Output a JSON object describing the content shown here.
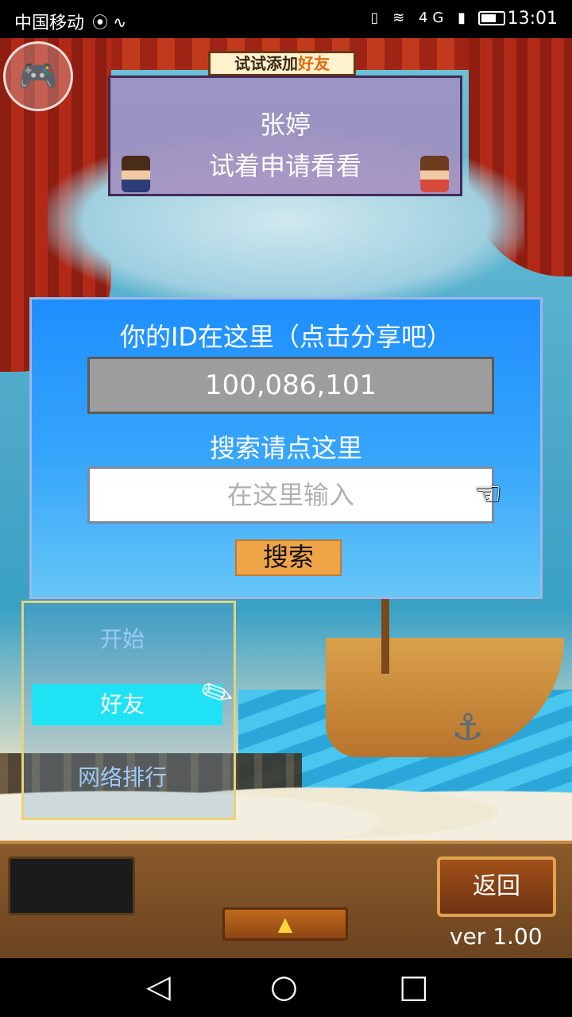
{
  "status_bar": {
    "carrier": "中国移动",
    "left_icons": "⦿ ∿",
    "right_icons": "▯ ≋ 4G ▮",
    "time": "13:01"
  },
  "banner": {
    "tag_prefix": "试试添加",
    "tag_highlight": "好友",
    "name": "张婷",
    "message": "试着申请看看"
  },
  "id_dialog": {
    "title": "你的ID在这里（点击分享吧）",
    "id_value": "100,086,101",
    "search_title": "搜索请点这里",
    "search_placeholder": "在这里输入",
    "search_button": "搜索"
  },
  "menu": {
    "items": [
      "开始",
      "好友",
      "网络排行"
    ],
    "selected": "好友"
  },
  "bottom": {
    "back_label": "返回",
    "arrow_glyph": "▲",
    "version": "ver 1.00"
  },
  "icons": {
    "gamepad": "🎮",
    "hand": "☜",
    "feather": "✎",
    "anchor": "⚓",
    "nav_back": "◁",
    "nav_home": "○",
    "nav_recent": "□"
  },
  "colors": {
    "dialog_top": "#1e8eff",
    "dialog_bottom": "#66c6f7",
    "search_button": "#f0a448",
    "menu_highlight": "#1fe3f5"
  }
}
